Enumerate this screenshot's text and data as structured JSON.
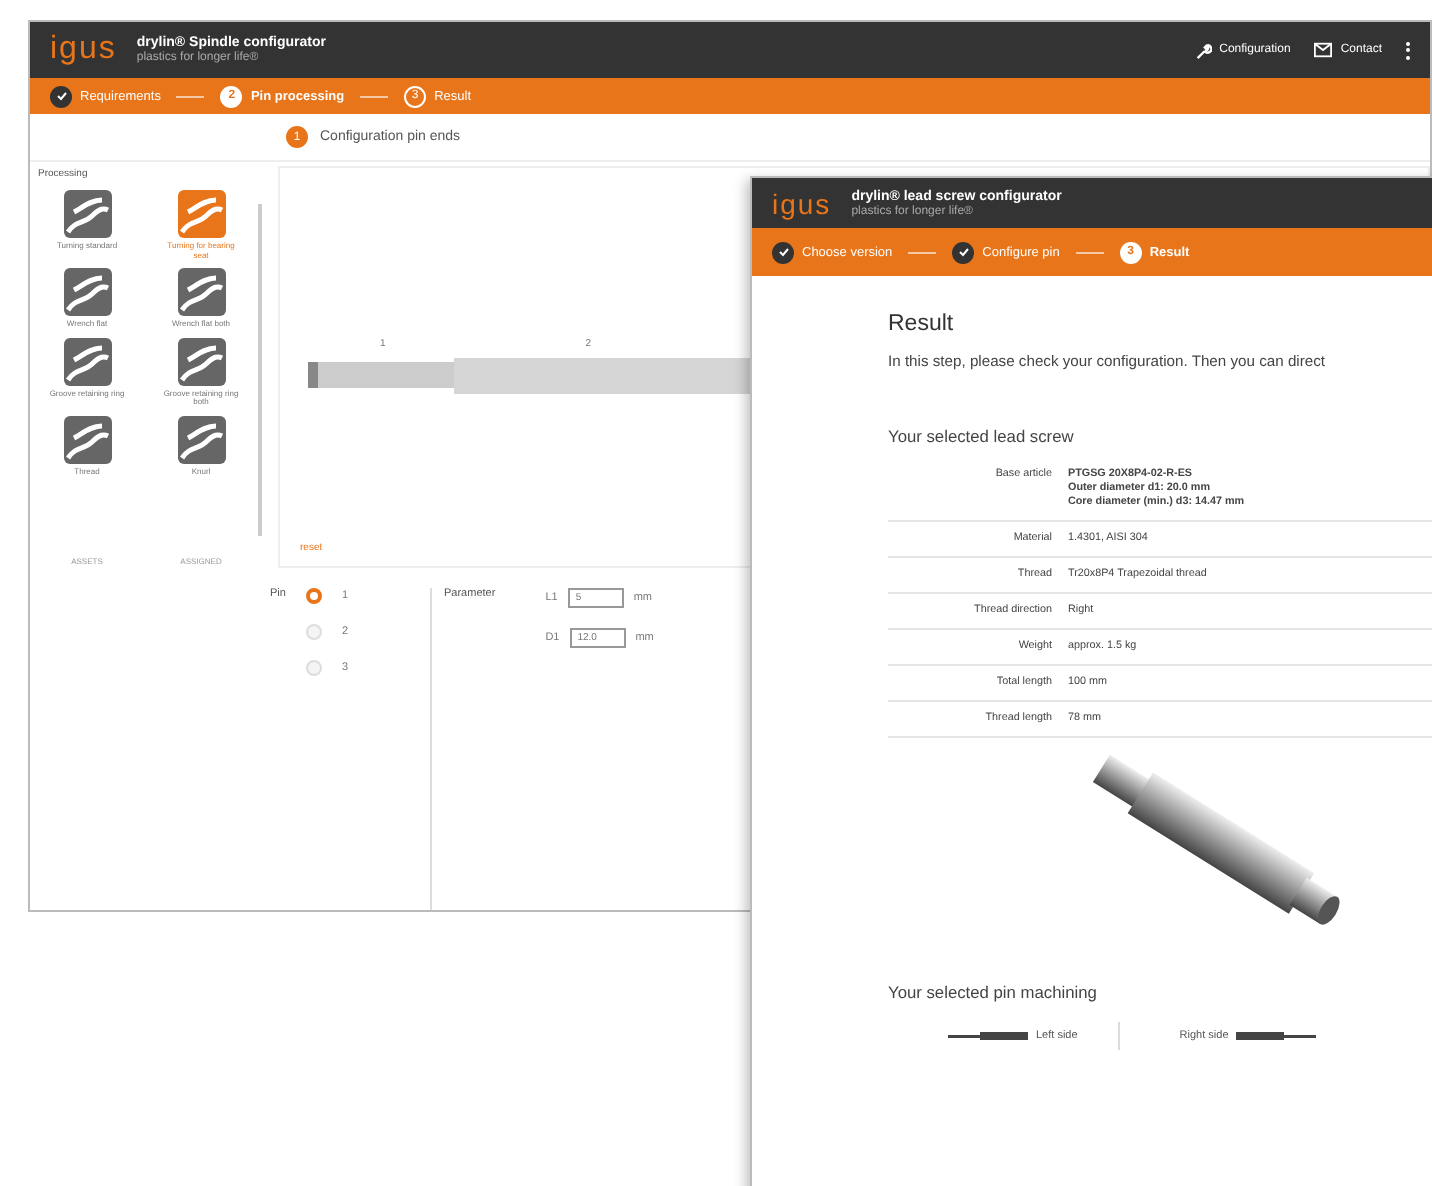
{
  "back_window": {
    "logo": "igus",
    "title": "drylin® Spindle configurator",
    "subtitle": "plastics for longer life®",
    "header_actions": [
      {
        "kind": "wrench",
        "label": "Configuration"
      },
      {
        "kind": "mail",
        "label": "Contact"
      }
    ],
    "steps": [
      {
        "label": "Requirements",
        "completed": true,
        "selected": false
      },
      {
        "number": "2",
        "label": "Pin processing",
        "completed": false,
        "selected": true
      },
      {
        "number": "3",
        "label": "Result",
        "completed": false,
        "selected": false
      }
    ],
    "heading": {
      "number": "1",
      "text": "Configuration pin ends"
    },
    "processing": {
      "title": "Processing",
      "tiles": [
        {
          "label": "Turning standard",
          "selected": false
        },
        {
          "label": "Turning for bearing seat",
          "selected": true
        },
        {
          "label": "Wrench flat",
          "selected": false
        },
        {
          "label": "Wrench flat both",
          "selected": false
        },
        {
          "label": "Groove retaining ring",
          "selected": false
        },
        {
          "label": "Groove retaining ring both",
          "selected": false
        },
        {
          "label": "Thread",
          "selected": false
        },
        {
          "label": "Knurl",
          "selected": false
        }
      ],
      "footer": [
        "ASSETS",
        "ASSIGNED"
      ]
    },
    "canvas": {
      "markers": [
        "1",
        "2"
      ],
      "reset": "reset"
    },
    "pins": {
      "label": "Pin",
      "options": [
        {
          "label": "1",
          "selected": true
        },
        {
          "label": "2",
          "selected": false
        },
        {
          "label": "3",
          "selected": false
        }
      ]
    },
    "parameters": {
      "label": "Parameter",
      "fields": [
        {
          "name": "L1",
          "value": "5",
          "unit": "mm"
        },
        {
          "name": "D1",
          "value": "12.0",
          "unit": "mm"
        }
      ]
    }
  },
  "front_window": {
    "logo": "igus",
    "title": "drylin® lead screw configurator",
    "subtitle": "plastics for longer life®",
    "steps": [
      {
        "label": "Choose version",
        "completed": true,
        "selected": false
      },
      {
        "label": "Configure pin",
        "completed": true,
        "selected": false
      },
      {
        "number": "3",
        "label": "Result",
        "completed": false,
        "selected": true
      }
    ],
    "heading": "Result",
    "intro": "In this step, please check your configuration. Then you can direct",
    "lead_screw": {
      "title": "Your selected lead screw",
      "rows": [
        {
          "label": "Base article",
          "values": [
            "PTGSG 20X8P4-02-R-ES",
            "Outer diameter d1: 20.0 mm",
            "Core diameter (min.) d3: 14.47 mm"
          ]
        },
        {
          "label": "Material",
          "values": [
            "1.4301, AISI 304"
          ]
        },
        {
          "label": "Thread",
          "values": [
            "Tr20x8P4 Trapezoidal thread"
          ]
        },
        {
          "label": "Thread direction",
          "values": [
            "Right"
          ]
        },
        {
          "label": "Weight",
          "values": [
            "approx. 1.5 kg"
          ]
        },
        {
          "label": "Total length",
          "values": [
            "100 mm"
          ]
        },
        {
          "label": "Thread length",
          "values": [
            "78 mm"
          ]
        }
      ]
    },
    "pin_machining": {
      "title": "Your selected pin machining",
      "sides": [
        "Left side",
        "Right side"
      ]
    }
  }
}
